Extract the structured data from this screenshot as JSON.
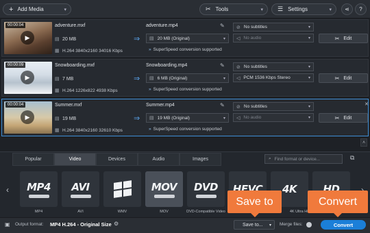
{
  "toolbar": {
    "add_media": "Add Media",
    "tools": "Tools",
    "settings": "Settings"
  },
  "files": [
    {
      "duration": "00:00:04",
      "source_name": "adventure.mxf",
      "source_size": "20 MB",
      "source_codec": "H.264 3840x2160 34016 Kbps",
      "output_name": "adventure.mp4",
      "output_size": "20 MB (Original)",
      "superspeed": "SuperSpeed conversion supported",
      "subtitles": "No subtitles",
      "audio": "No audio",
      "edit": "Edit"
    },
    {
      "duration": "00:00:09",
      "source_name": "Snowboarding.mxf",
      "source_size": "7 MB",
      "source_codec": "H.264 1226x822 4938 Kbps",
      "output_name": "Snowboarding.mp4",
      "output_size": "6 MB (Original)",
      "superspeed": "SuperSpeed conversion supported",
      "subtitles": "No subtitles",
      "audio": "PCM 1536 Kbps Stereo",
      "edit": "Edit"
    },
    {
      "duration": "00:00:04",
      "source_name": "Summer.mxf",
      "source_size": "19 MB",
      "source_codec": "H.264 3840x2160 32610 Kbps",
      "output_name": "Summer.mp4",
      "output_size": "19 MB (Original)",
      "superspeed": "SuperSpeed conversion supported",
      "subtitles": "No subtitles",
      "audio": "No audio",
      "edit": "Edit"
    }
  ],
  "tabs": [
    "Popular",
    "Video",
    "Devices",
    "Audio",
    "Images"
  ],
  "active_tab": "Video",
  "search_placeholder": "Find format or device...",
  "formats": [
    {
      "big": "MP4",
      "label": "MP4"
    },
    {
      "big": "AVI",
      "label": "AVI"
    },
    {
      "big": "",
      "label": "WMV"
    },
    {
      "big": "MOV",
      "label": "MOV"
    },
    {
      "big": "DVD",
      "label": "DVD-Compatible Video"
    },
    {
      "big": "HEVC",
      "label": "HEVC"
    },
    {
      "big": "4K",
      "label": "4K Ultra HD"
    },
    {
      "big": "HD",
      "label": "HD"
    }
  ],
  "callouts": {
    "save": "Save to",
    "convert": "Convert"
  },
  "bottom": {
    "output_format_label": "Output format:",
    "output_format_value": "MP4 H.264 - Original Size",
    "save_to": "Save to...",
    "merge_files": "Merge files:",
    "convert": "Convert"
  },
  "colors": {
    "accent": "#1b7fd8",
    "callout": "#f07a3c",
    "selection": "#3f8fd6"
  }
}
